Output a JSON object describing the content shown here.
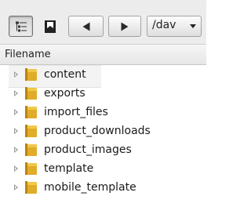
{
  "toolbar": {
    "tree_view_icon": "tree-view-icon",
    "bookmark_icon": "bookmark-icon",
    "back_icon": "arrow-left-icon",
    "forward_icon": "arrow-right-icon",
    "path_value": "/dav"
  },
  "file_list": {
    "column_header": "Filename",
    "items": [
      {
        "name": "content",
        "icon": "folder-icon",
        "highlighted": true
      },
      {
        "name": "exports",
        "icon": "folder-icon"
      },
      {
        "name": "import_files",
        "icon": "folder-icon"
      },
      {
        "name": "product_downloads",
        "icon": "folder-icon"
      },
      {
        "name": "product_images",
        "icon": "folder-icon"
      },
      {
        "name": "template",
        "icon": "folder-icon"
      },
      {
        "name": "mobile_template",
        "icon": "folder-icon"
      }
    ]
  },
  "colors": {
    "folder": "#d9a520",
    "toolbar_bg": "#ececec",
    "highlight_bg": "#f3f3f3"
  }
}
